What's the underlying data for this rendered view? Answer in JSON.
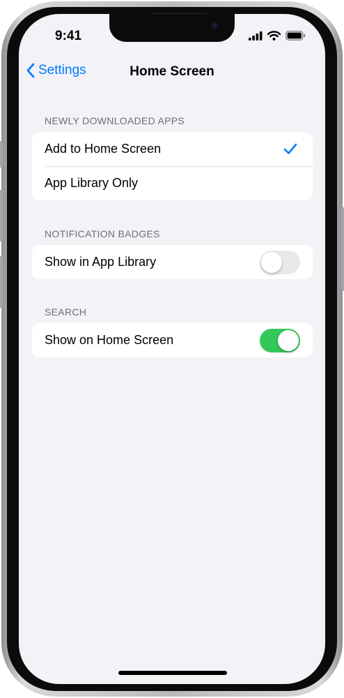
{
  "status_bar": {
    "time": "9:41",
    "icons": [
      "cellular-signal-icon",
      "wifi-icon",
      "battery-icon"
    ]
  },
  "nav": {
    "back_label": "Settings",
    "back_icon": "chevron-left-icon",
    "title": "Home Screen"
  },
  "sections": {
    "newly_downloaded": {
      "header": "NEWLY DOWNLOADED APPS",
      "options": [
        {
          "label": "Add to Home Screen",
          "selected": true
        },
        {
          "label": "App Library Only",
          "selected": false
        }
      ]
    },
    "notification_badges": {
      "header": "NOTIFICATION BADGES",
      "row_label": "Show in App Library",
      "toggle_on": false
    },
    "search": {
      "header": "SEARCH",
      "row_label": "Show on Home Screen",
      "toggle_on": true
    }
  },
  "colors": {
    "accent": "#007aff",
    "toggle_on": "#34c759",
    "toggle_off": "#e9e9ea",
    "background": "#f2f2f7"
  }
}
